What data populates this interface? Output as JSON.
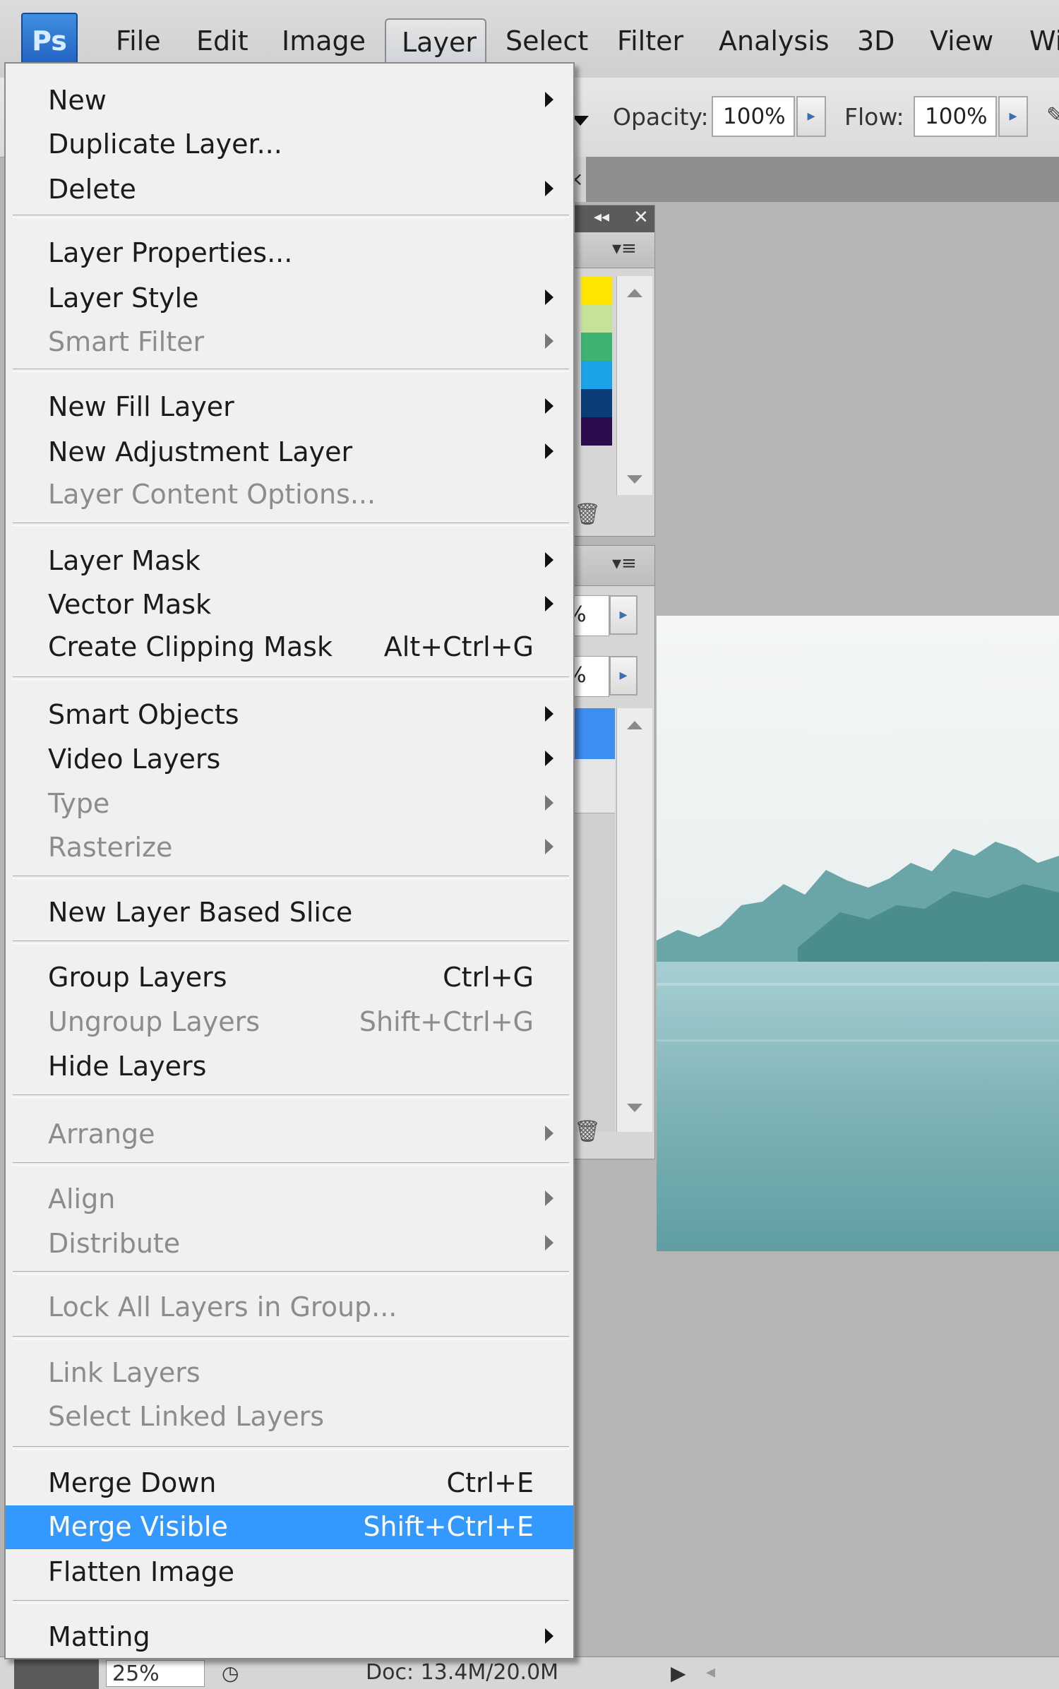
{
  "menubar": {
    "logo": "Ps",
    "items": [
      "File",
      "Edit",
      "Image",
      "Layer",
      "Select",
      "Filter",
      "Analysis",
      "3D",
      "View",
      "Wi"
    ]
  },
  "options": {
    "opacity_label": "Opacity:",
    "opacity_value": "100%",
    "flow_label": "Flow:",
    "flow_value": "100%"
  },
  "panels": {
    "swatch_colors": [
      "#ffe600",
      "#c4e29a",
      "#3cb371",
      "#1aa3e8",
      "#0b3c78",
      "#2b0d4e"
    ],
    "layers_opacity_partial": "%",
    "layers_fill_partial": "%"
  },
  "status": {
    "zoom": "25%",
    "doc": "Doc: 13.4M/20.0M"
  },
  "menu": {
    "new": "New",
    "duplicate": "Duplicate Layer...",
    "delete": "Delete",
    "layer_properties": "Layer Properties...",
    "layer_style": "Layer Style",
    "smart_filter": "Smart Filter",
    "new_fill_layer": "New Fill Layer",
    "new_adjustment_layer": "New Adjustment Layer",
    "layer_content_options": "Layer Content Options...",
    "layer_mask": "Layer Mask",
    "vector_mask": "Vector Mask",
    "create_clipping_mask": "Create Clipping Mask",
    "create_clipping_mask_shortcut": "Alt+Ctrl+G",
    "smart_objects": "Smart Objects",
    "video_layers": "Video Layers",
    "type": "Type",
    "rasterize": "Rasterize",
    "new_layer_based_slice": "New Layer Based Slice",
    "group_layers": "Group Layers",
    "group_layers_shortcut": "Ctrl+G",
    "ungroup_layers": "Ungroup Layers",
    "ungroup_layers_shortcut": "Shift+Ctrl+G",
    "hide_layers": "Hide Layers",
    "arrange": "Arrange",
    "align": "Align",
    "distribute": "Distribute",
    "lock_all_layers": "Lock All Layers in Group...",
    "link_layers": "Link Layers",
    "select_linked_layers": "Select Linked Layers",
    "merge_down": "Merge Down",
    "merge_down_shortcut": "Ctrl+E",
    "merge_visible": "Merge Visible",
    "merge_visible_shortcut": "Shift+Ctrl+E",
    "flatten_image": "Flatten Image",
    "matting": "Matting"
  }
}
